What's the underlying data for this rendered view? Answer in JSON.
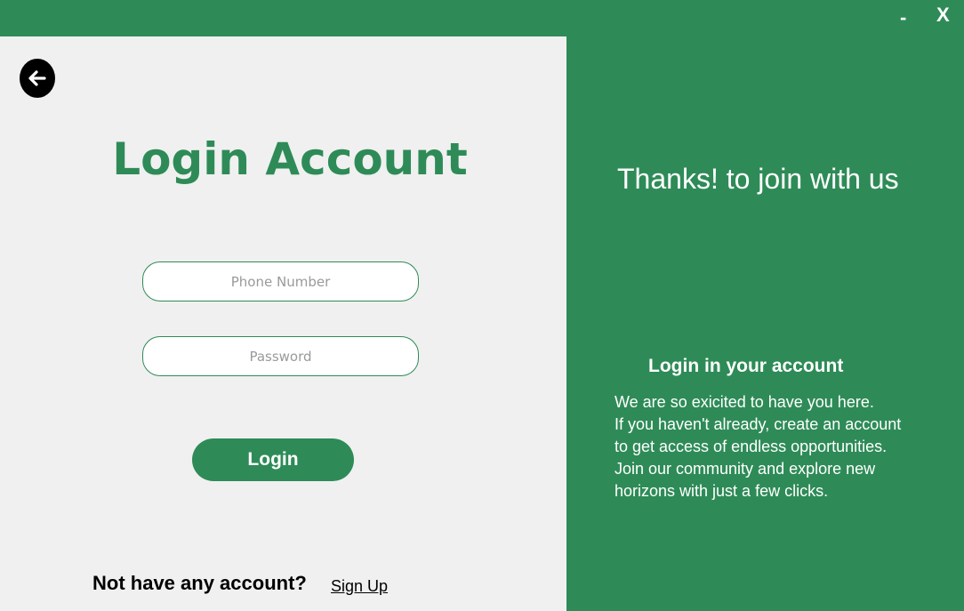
{
  "window": {
    "minimize_label": "-",
    "close_label": "X"
  },
  "login_panel": {
    "title": "Login Account",
    "phone_placeholder": "Phone Number",
    "password_placeholder": "Password",
    "login_button": "Login",
    "no_account_text": "Not have any account?",
    "signup_link": "Sign Up",
    "back_icon": "arrow-left-icon"
  },
  "welcome_panel": {
    "title": "Thanks! to join with us",
    "heading": "Login in your account",
    "description_lines": [
      "We are so exicited to have you here.",
      "If you haven't already, create an account",
      "to get access of endless opportunities.",
      "Join our community and explore new",
      "horizons with just a few clicks."
    ]
  },
  "colors": {
    "accent": "#2e8b57",
    "panel_background": "#f0f0f0",
    "text_on_accent": "#ffffff"
  }
}
